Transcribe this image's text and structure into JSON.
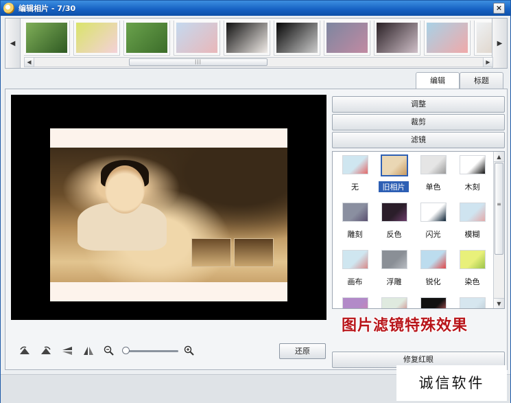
{
  "window": {
    "title": "编辑相片 - 7/30",
    "close_label": "×"
  },
  "filmstrip": {
    "left_arrow": "◀",
    "right_arrow": "▶",
    "scroll_left": "◀",
    "scroll_right": "▶",
    "scroll_grip": "|||",
    "thumbnails": [
      {
        "colors": [
          "#7fae58",
          "#2f5a23"
        ]
      },
      {
        "colors": [
          "#d9e46a",
          "#f4d1d8"
        ]
      },
      {
        "colors": [
          "#6aa24c",
          "#3c6d2a"
        ]
      },
      {
        "colors": [
          "#c4d9ef",
          "#e9b7b9"
        ]
      },
      {
        "colors": [
          "#111111",
          "#f1ece8"
        ]
      },
      {
        "colors": [
          "#050505",
          "#cccccc"
        ]
      },
      {
        "colors": [
          "#7d86a0",
          "#c18aa2"
        ]
      },
      {
        "colors": [
          "#2a2025",
          "#cfbfc8"
        ]
      },
      {
        "colors": [
          "#a8d1e6",
          "#f0a9a9"
        ]
      },
      {
        "colors": [
          "#eef1f4",
          "#d9c9b8"
        ]
      }
    ]
  },
  "tabs": [
    {
      "label": "编辑",
      "active": true
    },
    {
      "label": "标题",
      "active": false
    }
  ],
  "preview": {
    "toolbar_icons": [
      "rotate-left-icon",
      "rotate-right-icon",
      "flip-vertical-icon",
      "flip-horizontal-icon",
      "zoom-out-icon",
      "zoom-in-icon"
    ],
    "zoom_level": 0,
    "restore_label": "还原"
  },
  "accordion": {
    "adjust_label": "调整",
    "crop_label": "裁剪",
    "filter_label": "滤镜",
    "redeye_label": "修复红眼"
  },
  "filters": [
    {
      "label": "无",
      "colors": [
        "#cfe6f0",
        "#e36a6a"
      ],
      "selected": false
    },
    {
      "label": "旧相片",
      "colors": [
        "#ead7b4",
        "#c79a60"
      ],
      "selected": true
    },
    {
      "label": "单色",
      "colors": [
        "#e5e5e5",
        "#9a9a9a"
      ],
      "selected": false
    },
    {
      "label": "木刻",
      "colors": [
        "#ffffff",
        "#111111"
      ],
      "selected": false
    },
    {
      "label": "雕刻",
      "colors": [
        "#8a8fa0",
        "#5a5070"
      ],
      "selected": false
    },
    {
      "label": "反色",
      "colors": [
        "#2b1e2a",
        "#6c3c6a"
      ],
      "selected": false
    },
    {
      "label": "闪光",
      "colors": [
        "#ffffff",
        "#0a2033"
      ],
      "selected": false
    },
    {
      "label": "模糊",
      "colors": [
        "#cfe4f0",
        "#e4a9a9"
      ],
      "selected": false
    },
    {
      "label": "画布",
      "colors": [
        "#cfe6f0",
        "#d88a8a"
      ],
      "selected": false
    },
    {
      "label": "浮雕",
      "colors": [
        "#8a8f96",
        "#b8bcc2"
      ],
      "selected": false
    },
    {
      "label": "锐化",
      "colors": [
        "#bcdcee",
        "#e04848"
      ],
      "selected": false
    },
    {
      "label": "染色",
      "colors": [
        "#e8f07a",
        "#9cc44a"
      ],
      "selected": false
    },
    {
      "label": "",
      "colors": [
        "#b28ac8",
        "#d080b0"
      ],
      "selected": false
    },
    {
      "label": "",
      "colors": [
        "#dfeadf",
        "#cc7a7a"
      ],
      "selected": false
    },
    {
      "label": "",
      "colors": [
        "#111111",
        "#e26a6a"
      ],
      "selected": false
    },
    {
      "label": "",
      "colors": [
        "#d6e6ef",
        "#b9c7d0"
      ],
      "selected": false
    }
  ],
  "filter_scroll": {
    "up": "▲",
    "down": "▼",
    "grip": "≡"
  },
  "promo_text": "图片滤镜特殊效果",
  "watermark_text": "诚信软件"
}
